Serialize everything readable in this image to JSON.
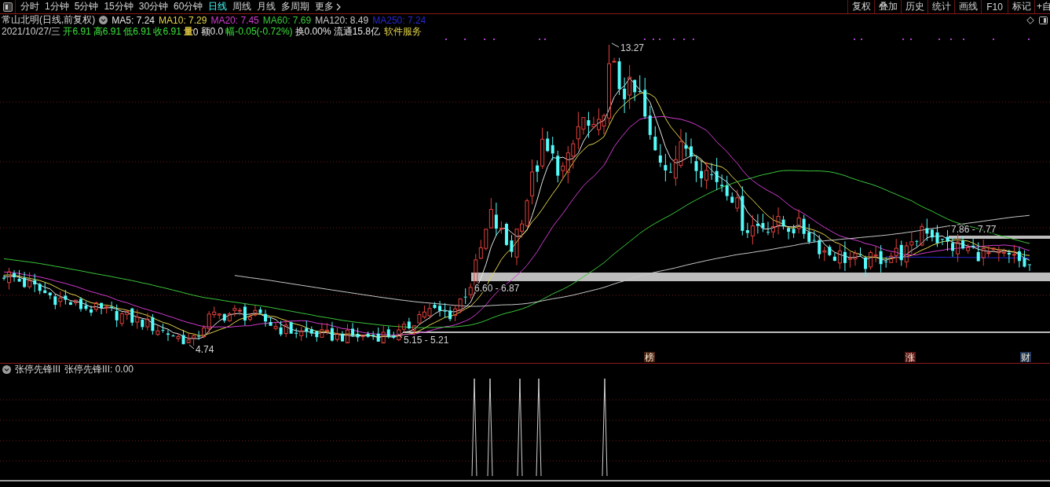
{
  "toolbar": {
    "tabs": [
      {
        "label": "分时",
        "selected": false
      },
      {
        "label": "1分钟",
        "selected": false
      },
      {
        "label": "5分钟",
        "selected": false
      },
      {
        "label": "15分钟",
        "selected": false
      },
      {
        "label": "30分钟",
        "selected": false
      },
      {
        "label": "60分钟",
        "selected": false
      },
      {
        "label": "日线",
        "selected": true
      },
      {
        "label": "周线",
        "selected": false
      },
      {
        "label": "月线",
        "selected": false
      },
      {
        "label": "多周期",
        "selected": false
      },
      {
        "label": "更多",
        "selected": false
      }
    ],
    "buttons": [
      "复权",
      "叠加",
      "历史",
      "统计",
      "画线",
      "F10",
      "标记",
      "+自"
    ]
  },
  "quote_header": {
    "title": "常山北明(日线,前复权)",
    "moving_averages": [
      {
        "label": "MA5: 7.24",
        "color": "#e8e8e8"
      },
      {
        "label": "MA10: 7.29",
        "color": "#e6d64a"
      },
      {
        "label": "MA20: 7.45",
        "color": "#d23cd2"
      },
      {
        "label": "MA60: 7.69",
        "color": "#3cc83c"
      },
      {
        "label": "MA120: 8.49",
        "color": "#c8c8c8"
      },
      {
        "label": "MA250: 7.24",
        "color": "#2828d2"
      }
    ],
    "date": "2021/10/27/三",
    "fields": [
      {
        "kind": "quote",
        "label": "开",
        "value": "6.91",
        "color": "#3ce03c"
      },
      {
        "kind": "quote",
        "label": "高",
        "value": "6.91",
        "color": "#3ce03c"
      },
      {
        "kind": "quote",
        "label": "低",
        "value": "6.91",
        "color": "#3ce03c"
      },
      {
        "kind": "quote",
        "label": "收",
        "value": "6.91",
        "color": "#3ce03c"
      },
      {
        "kind": "volume",
        "label": "量",
        "value": "0",
        "color": "#d8c040"
      },
      {
        "kind": "quote",
        "label": "额",
        "value": "0.0",
        "color": "#e8e8e8"
      },
      {
        "kind": "quote",
        "label": "幅",
        "value": "-0.05(-0.72%)",
        "color": "#3ce03c"
      },
      {
        "kind": "quote",
        "label": "换",
        "value": "0.00%",
        "color": "#e8e8e8"
      },
      {
        "kind": "quote",
        "label": "流通",
        "value": "15.8亿",
        "color": "#e8e8e8"
      }
    ],
    "sector": "软件服务"
  },
  "price_chart": {
    "annotations": [
      "13.27",
      "4.74",
      "5.15 - 5.21",
      "6.60 - 6.87",
      "7.86 - 7.77"
    ],
    "event_tags": [
      {
        "text": "榜",
        "color": "#4a2212"
      },
      {
        "text": "涨",
        "color": "#5a1414"
      },
      {
        "text": "财",
        "color": "#1e3658"
      }
    ]
  },
  "indicator": {
    "name": "张停先锋III",
    "reading": "张停先锋III: 0.00"
  }
}
